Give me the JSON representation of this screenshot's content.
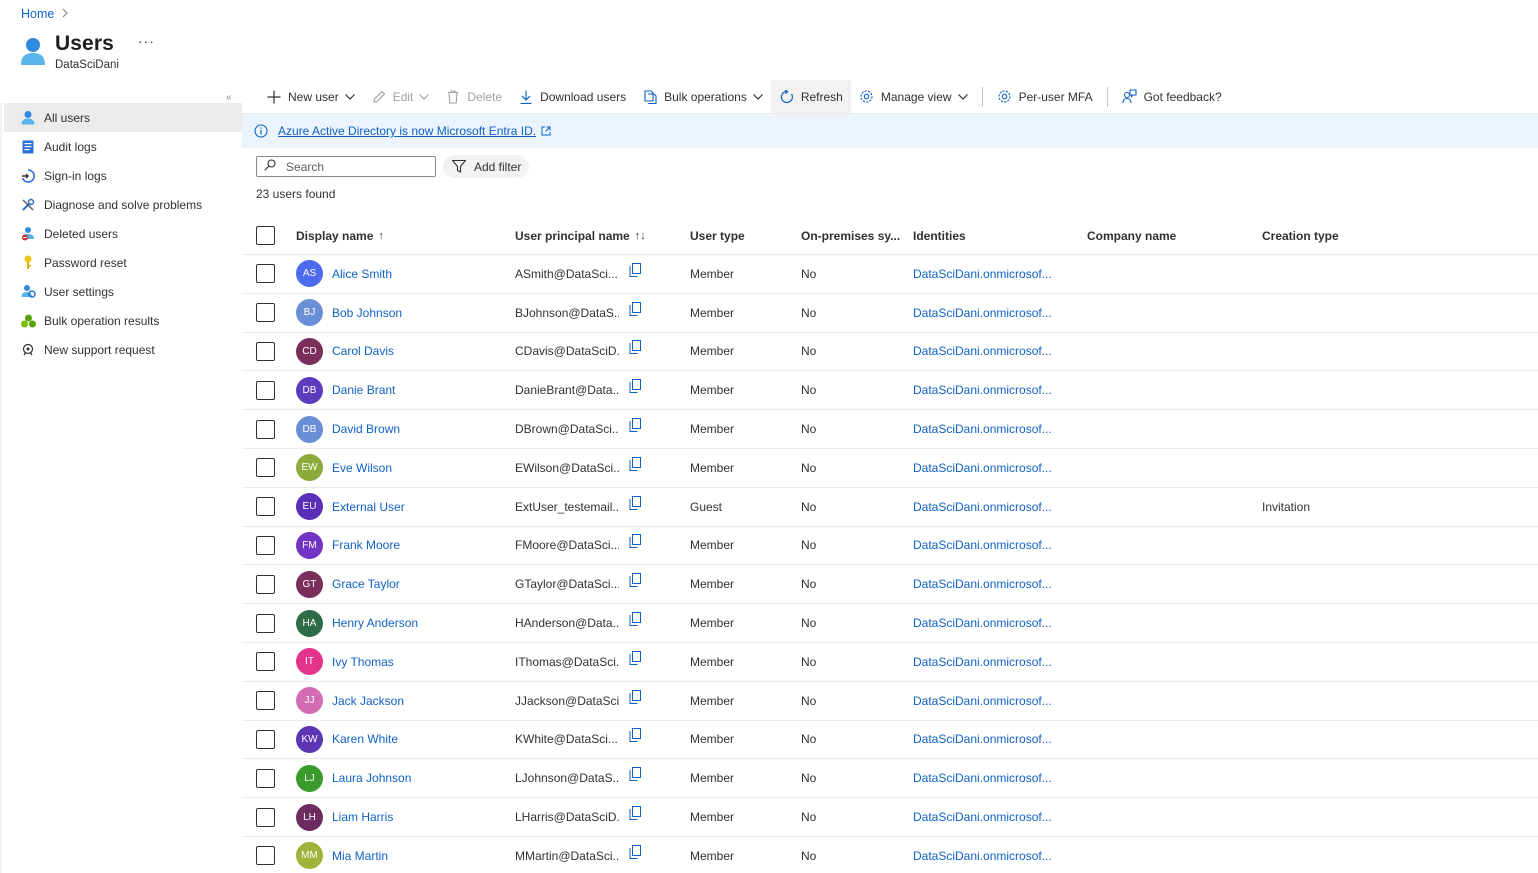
{
  "breadcrumb": {
    "home": "Home"
  },
  "header": {
    "title": "Users",
    "subtitle": "DataSciDani",
    "more": "···"
  },
  "sidebar": {
    "collapse": "«",
    "items": [
      {
        "label": "All users",
        "icon": "user-icon",
        "active": true
      },
      {
        "label": "Audit logs",
        "icon": "audit-log-icon"
      },
      {
        "label": "Sign-in logs",
        "icon": "sign-in-icon"
      },
      {
        "label": "Diagnose and solve problems",
        "icon": "wrench-icon"
      },
      {
        "label": "Deleted users",
        "icon": "deleted-user-icon"
      },
      {
        "label": "Password reset",
        "icon": "key-icon"
      },
      {
        "label": "User settings",
        "icon": "user-settings-icon"
      },
      {
        "label": "Bulk operation results",
        "icon": "bulk-results-icon"
      },
      {
        "label": "New support request",
        "icon": "support-icon"
      }
    ]
  },
  "toolbar": {
    "new_user": "New user",
    "edit": "Edit",
    "delete": "Delete",
    "download": "Download users",
    "bulk": "Bulk operations",
    "refresh": "Refresh",
    "manage_view": "Manage view",
    "per_user_mfa": "Per-user MFA",
    "feedback": "Got feedback?"
  },
  "info": {
    "message": "Azure Active Directory is now Microsoft Entra ID."
  },
  "search": {
    "placeholder": "Search",
    "value": ""
  },
  "filter": {
    "label": "Add filter"
  },
  "results": {
    "count_text": "23 users found"
  },
  "table": {
    "columns": {
      "display_name": "Display name",
      "display_name_sort": "↑",
      "upn": "User principal name",
      "upn_sort": "↑↓",
      "user_type": "User type",
      "on_prem": "On-premises sy...",
      "identities": "Identities",
      "company": "Company name",
      "creation": "Creation type"
    },
    "rows": [
      {
        "initials": "AS",
        "color": "#4f6bed",
        "name": "Alice Smith",
        "upn": "ASmith@DataSci...",
        "type": "Member",
        "onprem": "No",
        "identity": "DataSciDani.onmicrosof...",
        "company": "",
        "creation": ""
      },
      {
        "initials": "BJ",
        "color": "#6b8fd6",
        "name": "Bob Johnson",
        "upn": "BJohnson@DataS...",
        "type": "Member",
        "onprem": "No",
        "identity": "DataSciDani.onmicrosof...",
        "company": "",
        "creation": ""
      },
      {
        "initials": "CD",
        "color": "#7a2e5a",
        "name": "Carol Davis",
        "upn": "CDavis@DataSciD...",
        "type": "Member",
        "onprem": "No",
        "identity": "DataSciDani.onmicrosof...",
        "company": "",
        "creation": ""
      },
      {
        "initials": "DB",
        "color": "#5c3bbf",
        "name": "Danie Brant",
        "upn": "DanieBrant@Data...",
        "type": "Member",
        "onprem": "No",
        "identity": "DataSciDani.onmicrosof...",
        "company": "",
        "creation": ""
      },
      {
        "initials": "DB",
        "color": "#6b8fd6",
        "name": "David Brown",
        "upn": "DBrown@DataSci...",
        "type": "Member",
        "onprem": "No",
        "identity": "DataSciDani.onmicrosof...",
        "company": "",
        "creation": ""
      },
      {
        "initials": "EW",
        "color": "#8cab3b",
        "name": "Eve Wilson",
        "upn": "EWilson@DataSci...",
        "type": "Member",
        "onprem": "No",
        "identity": "DataSciDani.onmicrosof...",
        "company": "",
        "creation": ""
      },
      {
        "initials": "EU",
        "color": "#5a2fb8",
        "name": "External User",
        "upn": "ExtUser_testemail....",
        "type": "Guest",
        "onprem": "No",
        "identity": "DataSciDani.onmicrosof...",
        "company": "",
        "creation": "Invitation"
      },
      {
        "initials": "FM",
        "color": "#7234c4",
        "name": "Frank Moore",
        "upn": "FMoore@DataSci...",
        "type": "Member",
        "onprem": "No",
        "identity": "DataSciDani.onmicrosof...",
        "company": "",
        "creation": ""
      },
      {
        "initials": "GT",
        "color": "#7a2e5a",
        "name": "Grace Taylor",
        "upn": "GTaylor@DataSci...",
        "type": "Member",
        "onprem": "No",
        "identity": "DataSciDani.onmicrosof...",
        "company": "",
        "creation": ""
      },
      {
        "initials": "HA",
        "color": "#2f6b46",
        "name": "Henry Anderson",
        "upn": "HAnderson@Data...",
        "type": "Member",
        "onprem": "No",
        "identity": "DataSciDani.onmicrosof...",
        "company": "",
        "creation": ""
      },
      {
        "initials": "IT",
        "color": "#e3338c",
        "name": "Ivy Thomas",
        "upn": "IThomas@DataSci...",
        "type": "Member",
        "onprem": "No",
        "identity": "DataSciDani.onmicrosof...",
        "company": "",
        "creation": ""
      },
      {
        "initials": "JJ",
        "color": "#d36cb4",
        "name": "Jack Jackson",
        "upn": "JJackson@DataSci...",
        "type": "Member",
        "onprem": "No",
        "identity": "DataSciDani.onmicrosof...",
        "company": "",
        "creation": ""
      },
      {
        "initials": "KW",
        "color": "#5c35b5",
        "name": "Karen White",
        "upn": "KWhite@DataSci...",
        "type": "Member",
        "onprem": "No",
        "identity": "DataSciDani.onmicrosof...",
        "company": "",
        "creation": ""
      },
      {
        "initials": "LJ",
        "color": "#3a9a2c",
        "name": "Laura Johnson",
        "upn": "LJohnson@DataS...",
        "type": "Member",
        "onprem": "No",
        "identity": "DataSciDani.onmicrosof...",
        "company": "",
        "creation": ""
      },
      {
        "initials": "LH",
        "color": "#6e2b61",
        "name": "Liam Harris",
        "upn": "LHarris@DataSciD...",
        "type": "Member",
        "onprem": "No",
        "identity": "DataSciDani.onmicrosof...",
        "company": "",
        "creation": ""
      },
      {
        "initials": "MM",
        "color": "#9db33a",
        "name": "Mia Martin",
        "upn": "MMartin@DataSci...",
        "type": "Member",
        "onprem": "No",
        "identity": "DataSciDani.onmicrosof...",
        "company": "",
        "creation": ""
      }
    ]
  },
  "colors": {
    "accent": "#0f62c4",
    "info_bg": "#ebf3fc",
    "active_bg": "#edebe9"
  }
}
